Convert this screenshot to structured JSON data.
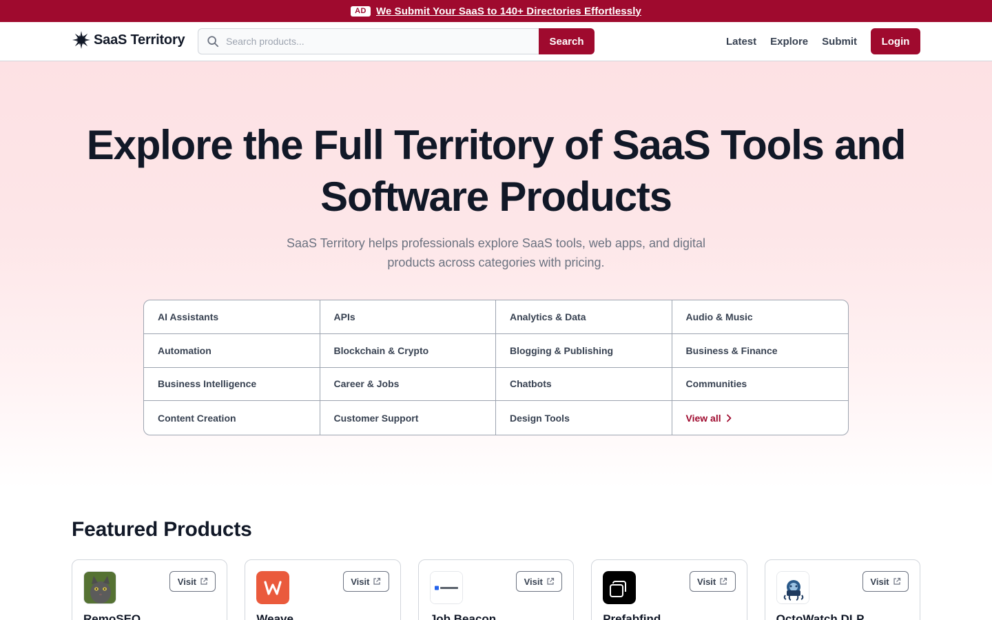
{
  "ad": {
    "badge": "AD",
    "link": "We Submit Your SaaS to 140+ Directories Effortlessly"
  },
  "header": {
    "logo_text": "SaaS Territory",
    "search_placeholder": "Search products...",
    "search_button": "Search",
    "nav": [
      "Latest",
      "Explore",
      "Submit"
    ],
    "login": "Login"
  },
  "hero": {
    "title": "Explore the Full Territory of SaaS Tools and Software Products",
    "subtitle": "SaaS Territory helps professionals explore SaaS tools, web apps, and digital products across categories with pricing."
  },
  "categories": [
    "AI Assistants",
    "APIs",
    "Analytics & Data",
    "Audio & Music",
    "Automation",
    "Blockchain & Crypto",
    "Blogging & Publishing",
    "Business & Finance",
    "Business Intelligence",
    "Career & Jobs",
    "Chatbots",
    "Communities",
    "Content Creation",
    "Customer Support",
    "Design Tools"
  ],
  "view_all": "View all",
  "featured": {
    "title": "Featured Products",
    "visit_label": "Visit",
    "products": [
      {
        "name": "RemoSEO",
        "logo": "cat-photo"
      },
      {
        "name": "Weave",
        "logo": "weave-w-logo"
      },
      {
        "name": "Job Beacon",
        "logo": "jobbeacon-logo"
      },
      {
        "name": "Prefabfind",
        "logo": "prefabfind-logo"
      },
      {
        "name": "OctoWatch DLP",
        "logo": "octowatch-logo"
      }
    ]
  },
  "colors": {
    "brand": "#9f0a2e",
    "hero_bg": "#fde1e4"
  }
}
